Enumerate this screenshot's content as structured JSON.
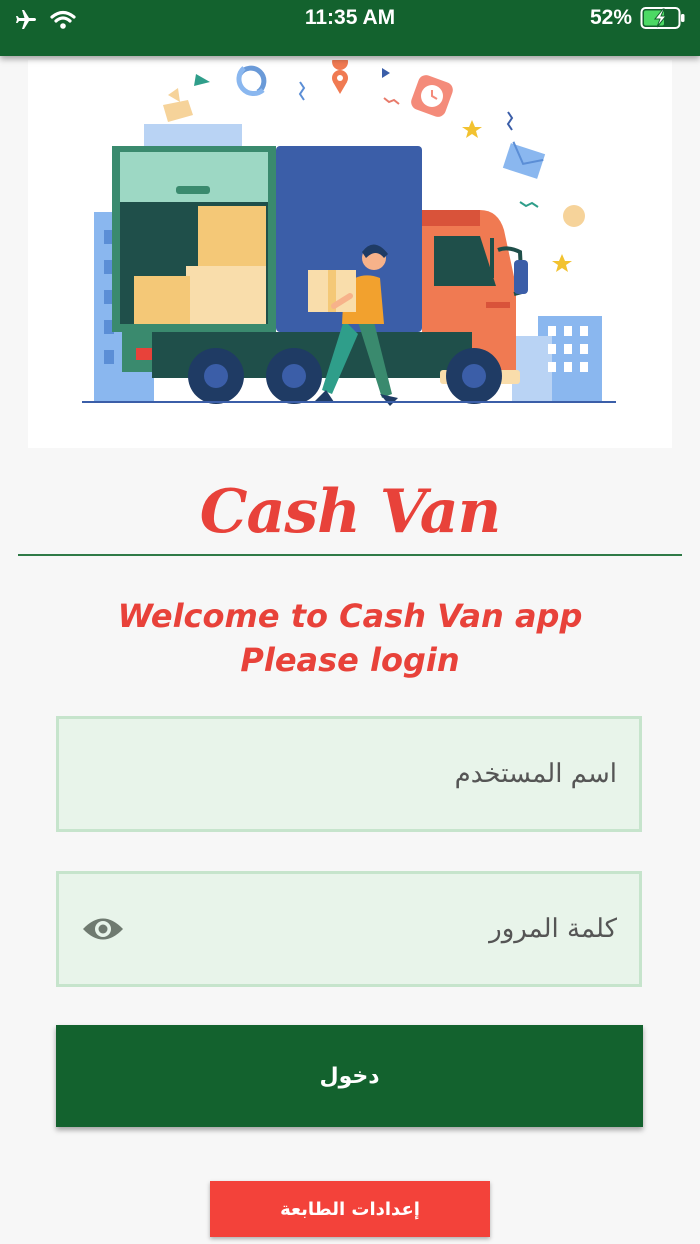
{
  "status_bar": {
    "time": "11:35 AM",
    "battery": "52%",
    "icons": [
      "airplane-icon",
      "wifi-icon",
      "battery-charging-icon"
    ]
  },
  "brand": {
    "title": "Cash Van"
  },
  "welcome": {
    "line1": "Welcome to Cash Van app",
    "line2": "Please login"
  },
  "form": {
    "username_placeholder": "اسم المستخدم",
    "username_value": "",
    "password_placeholder": "كلمة المرور",
    "password_value": "",
    "login_label": "دخول"
  },
  "printer_settings_label": "إعدادات الطابعة",
  "colors": {
    "primary": "#13622e",
    "accent": "#e8423a",
    "field_bg": "#e8f4ea",
    "field_border": "#c6e4cc"
  }
}
